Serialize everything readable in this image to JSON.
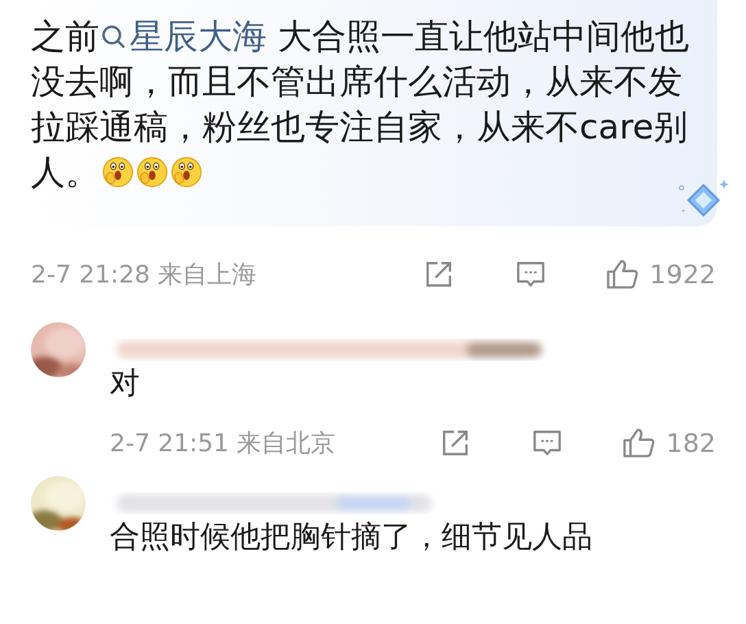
{
  "post": {
    "text_before": "之前",
    "topic": "星辰大海",
    "text_after": " 大合照一直让他站中间他也没去啊，而且不管出席什么活动，从来不发拉踩通稿，粉丝也专注自家，从来不care别人。",
    "emojis": [
      {
        "kind": "cover-mouth"
      },
      {
        "kind": "cover-mouth"
      },
      {
        "kind": "cover-mouth"
      }
    ],
    "time": "2-7 21:28",
    "location": "来自上海",
    "likes": "1922"
  },
  "replies": [
    {
      "text": "对",
      "time": "2-7 21:51",
      "location": "来自北京",
      "likes": "182"
    },
    {
      "text": "合照时候他把胸针摘了，细节见人品"
    }
  ]
}
